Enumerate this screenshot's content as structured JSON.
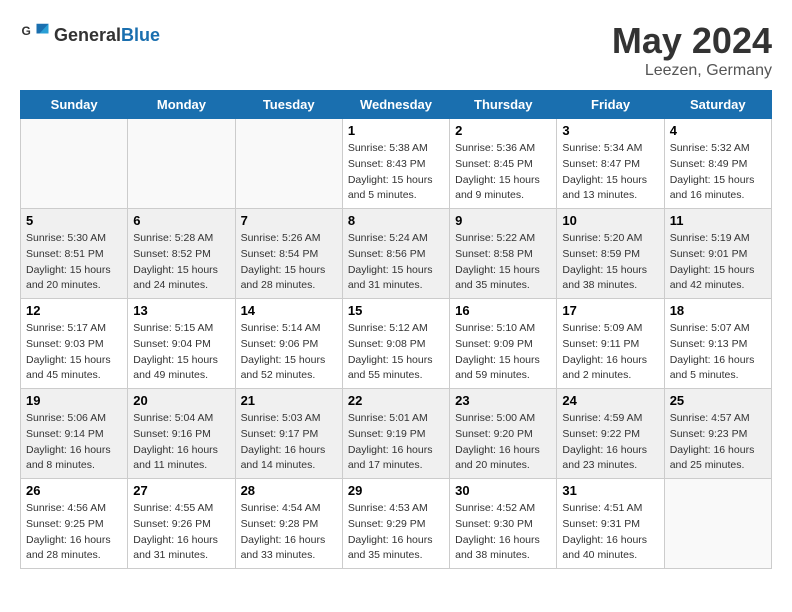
{
  "logo": {
    "general": "General",
    "blue": "Blue"
  },
  "title": {
    "month": "May 2024",
    "location": "Leezen, Germany"
  },
  "days_header": [
    "Sunday",
    "Monday",
    "Tuesday",
    "Wednesday",
    "Thursday",
    "Friday",
    "Saturday"
  ],
  "weeks": [
    {
      "alt": false,
      "days": [
        {
          "num": "",
          "info": ""
        },
        {
          "num": "",
          "info": ""
        },
        {
          "num": "",
          "info": ""
        },
        {
          "num": "1",
          "info": "Sunrise: 5:38 AM\nSunset: 8:43 PM\nDaylight: 15 hours\nand 5 minutes."
        },
        {
          "num": "2",
          "info": "Sunrise: 5:36 AM\nSunset: 8:45 PM\nDaylight: 15 hours\nand 9 minutes."
        },
        {
          "num": "3",
          "info": "Sunrise: 5:34 AM\nSunset: 8:47 PM\nDaylight: 15 hours\nand 13 minutes."
        },
        {
          "num": "4",
          "info": "Sunrise: 5:32 AM\nSunset: 8:49 PM\nDaylight: 15 hours\nand 16 minutes."
        }
      ]
    },
    {
      "alt": true,
      "days": [
        {
          "num": "5",
          "info": "Sunrise: 5:30 AM\nSunset: 8:51 PM\nDaylight: 15 hours\nand 20 minutes."
        },
        {
          "num": "6",
          "info": "Sunrise: 5:28 AM\nSunset: 8:52 PM\nDaylight: 15 hours\nand 24 minutes."
        },
        {
          "num": "7",
          "info": "Sunrise: 5:26 AM\nSunset: 8:54 PM\nDaylight: 15 hours\nand 28 minutes."
        },
        {
          "num": "8",
          "info": "Sunrise: 5:24 AM\nSunset: 8:56 PM\nDaylight: 15 hours\nand 31 minutes."
        },
        {
          "num": "9",
          "info": "Sunrise: 5:22 AM\nSunset: 8:58 PM\nDaylight: 15 hours\nand 35 minutes."
        },
        {
          "num": "10",
          "info": "Sunrise: 5:20 AM\nSunset: 8:59 PM\nDaylight: 15 hours\nand 38 minutes."
        },
        {
          "num": "11",
          "info": "Sunrise: 5:19 AM\nSunset: 9:01 PM\nDaylight: 15 hours\nand 42 minutes."
        }
      ]
    },
    {
      "alt": false,
      "days": [
        {
          "num": "12",
          "info": "Sunrise: 5:17 AM\nSunset: 9:03 PM\nDaylight: 15 hours\nand 45 minutes."
        },
        {
          "num": "13",
          "info": "Sunrise: 5:15 AM\nSunset: 9:04 PM\nDaylight: 15 hours\nand 49 minutes."
        },
        {
          "num": "14",
          "info": "Sunrise: 5:14 AM\nSunset: 9:06 PM\nDaylight: 15 hours\nand 52 minutes."
        },
        {
          "num": "15",
          "info": "Sunrise: 5:12 AM\nSunset: 9:08 PM\nDaylight: 15 hours\nand 55 minutes."
        },
        {
          "num": "16",
          "info": "Sunrise: 5:10 AM\nSunset: 9:09 PM\nDaylight: 15 hours\nand 59 minutes."
        },
        {
          "num": "17",
          "info": "Sunrise: 5:09 AM\nSunset: 9:11 PM\nDaylight: 16 hours\nand 2 minutes."
        },
        {
          "num": "18",
          "info": "Sunrise: 5:07 AM\nSunset: 9:13 PM\nDaylight: 16 hours\nand 5 minutes."
        }
      ]
    },
    {
      "alt": true,
      "days": [
        {
          "num": "19",
          "info": "Sunrise: 5:06 AM\nSunset: 9:14 PM\nDaylight: 16 hours\nand 8 minutes."
        },
        {
          "num": "20",
          "info": "Sunrise: 5:04 AM\nSunset: 9:16 PM\nDaylight: 16 hours\nand 11 minutes."
        },
        {
          "num": "21",
          "info": "Sunrise: 5:03 AM\nSunset: 9:17 PM\nDaylight: 16 hours\nand 14 minutes."
        },
        {
          "num": "22",
          "info": "Sunrise: 5:01 AM\nSunset: 9:19 PM\nDaylight: 16 hours\nand 17 minutes."
        },
        {
          "num": "23",
          "info": "Sunrise: 5:00 AM\nSunset: 9:20 PM\nDaylight: 16 hours\nand 20 minutes."
        },
        {
          "num": "24",
          "info": "Sunrise: 4:59 AM\nSunset: 9:22 PM\nDaylight: 16 hours\nand 23 minutes."
        },
        {
          "num": "25",
          "info": "Sunrise: 4:57 AM\nSunset: 9:23 PM\nDaylight: 16 hours\nand 25 minutes."
        }
      ]
    },
    {
      "alt": false,
      "days": [
        {
          "num": "26",
          "info": "Sunrise: 4:56 AM\nSunset: 9:25 PM\nDaylight: 16 hours\nand 28 minutes."
        },
        {
          "num": "27",
          "info": "Sunrise: 4:55 AM\nSunset: 9:26 PM\nDaylight: 16 hours\nand 31 minutes."
        },
        {
          "num": "28",
          "info": "Sunrise: 4:54 AM\nSunset: 9:28 PM\nDaylight: 16 hours\nand 33 minutes."
        },
        {
          "num": "29",
          "info": "Sunrise: 4:53 AM\nSunset: 9:29 PM\nDaylight: 16 hours\nand 35 minutes."
        },
        {
          "num": "30",
          "info": "Sunrise: 4:52 AM\nSunset: 9:30 PM\nDaylight: 16 hours\nand 38 minutes."
        },
        {
          "num": "31",
          "info": "Sunrise: 4:51 AM\nSunset: 9:31 PM\nDaylight: 16 hours\nand 40 minutes."
        },
        {
          "num": "",
          "info": ""
        }
      ]
    }
  ]
}
